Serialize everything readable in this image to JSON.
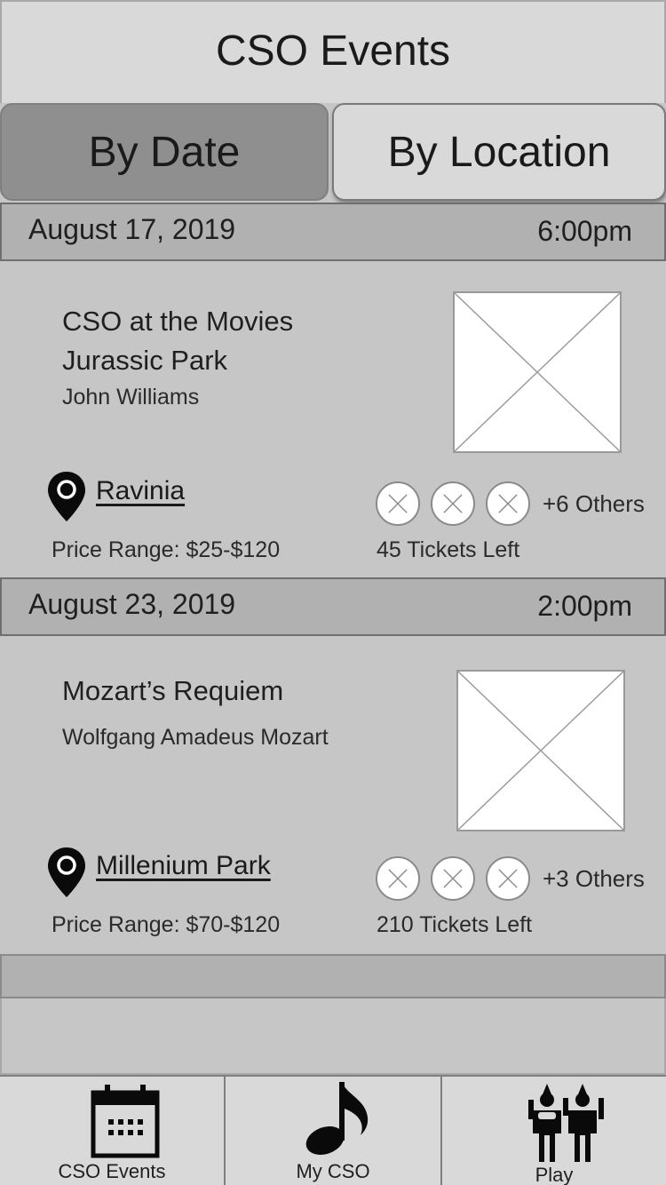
{
  "header": {
    "title": "CSO Events"
  },
  "tabs": [
    {
      "label": "By Date"
    },
    {
      "label": "By Location"
    }
  ],
  "events": [
    {
      "date": "August  17, 2019",
      "time": "6:00pm",
      "title_line1": "CSO at the Movies",
      "title_line2": "Jurassic Park",
      "composer": "John Williams",
      "location": "Ravinia",
      "price_range": "Price Range: $25-$120",
      "others": "+6 Others",
      "tickets_left": "45 Tickets Left"
    },
    {
      "date": "August 23, 2019",
      "time": "2:00pm",
      "title_line1": "Mozart’s Requiem",
      "composer": "Wolfgang Amadeus Mozart",
      "location": "Millenium Park",
      "price_range": "Price Range: $70-$120",
      "others": "+3 Others",
      "tickets_left": "210 Tickets Left"
    }
  ],
  "bottom_nav": [
    {
      "label": "CSO Events",
      "icon": "calendar-icon"
    },
    {
      "label": "My CSO",
      "icon": "music-note-icon"
    },
    {
      "label": "Play",
      "icon": "play-figures-icon"
    }
  ]
}
